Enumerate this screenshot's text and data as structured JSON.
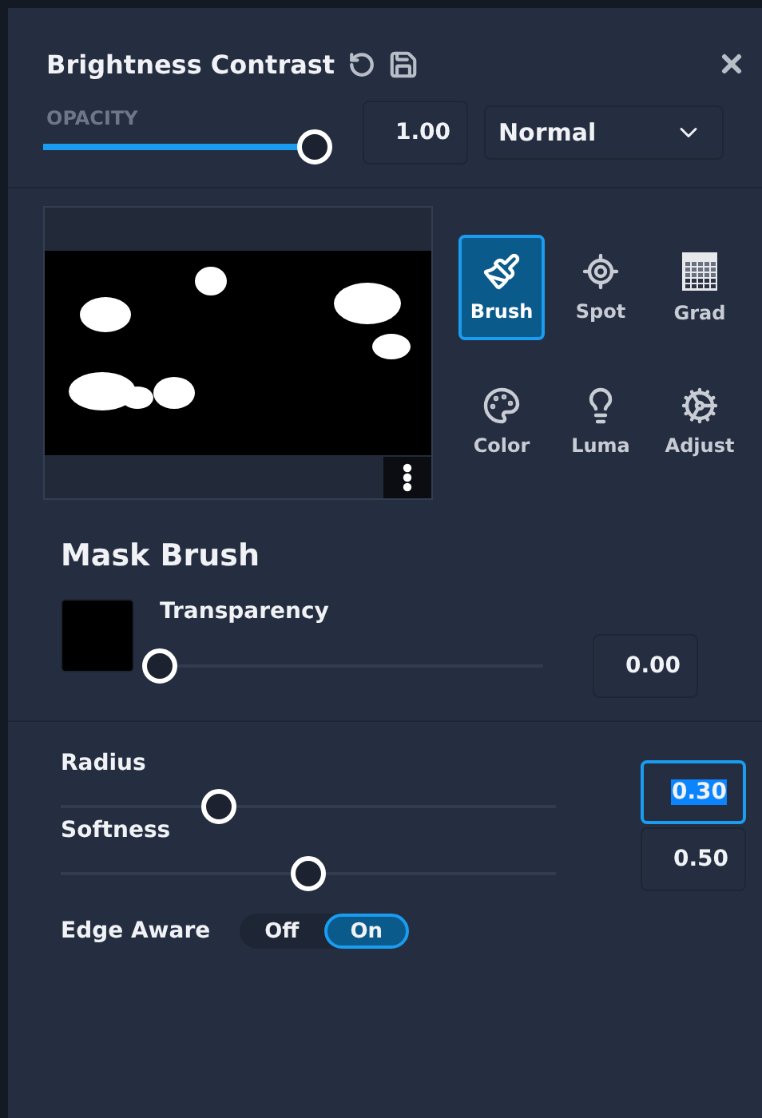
{
  "panel": {
    "title": "Brightness Contrast"
  },
  "opacity": {
    "label": "OPACITY",
    "level": 1.0,
    "value": "1.00",
    "blend_mode": "Normal"
  },
  "tools": [
    {
      "kind": "brush",
      "label": "Brush",
      "selected": true
    },
    {
      "kind": "spot",
      "label": "Spot",
      "selected": false
    },
    {
      "kind": "grad",
      "label": "Grad",
      "selected": false
    },
    {
      "kind": "color",
      "label": "Color",
      "selected": false
    },
    {
      "kind": "luma",
      "label": "Luma",
      "selected": false
    },
    {
      "kind": "adjust",
      "label": "Adjust",
      "selected": false
    }
  ],
  "mask_brush": {
    "heading": "Mask Brush",
    "transparency": {
      "label": "Transparency",
      "level": 0.0,
      "value": "0.00",
      "focused": false
    }
  },
  "brush_settings": [
    {
      "label": "Radius",
      "level": 0.32,
      "value": "0.30",
      "focused": true
    },
    {
      "label": "Softness",
      "level": 0.5,
      "value": "0.50",
      "focused": false
    }
  ],
  "edge_aware": {
    "label": "Edge Aware",
    "options": [
      {
        "label": "Off",
        "selected": false
      },
      {
        "label": "On",
        "selected": true
      }
    ]
  }
}
